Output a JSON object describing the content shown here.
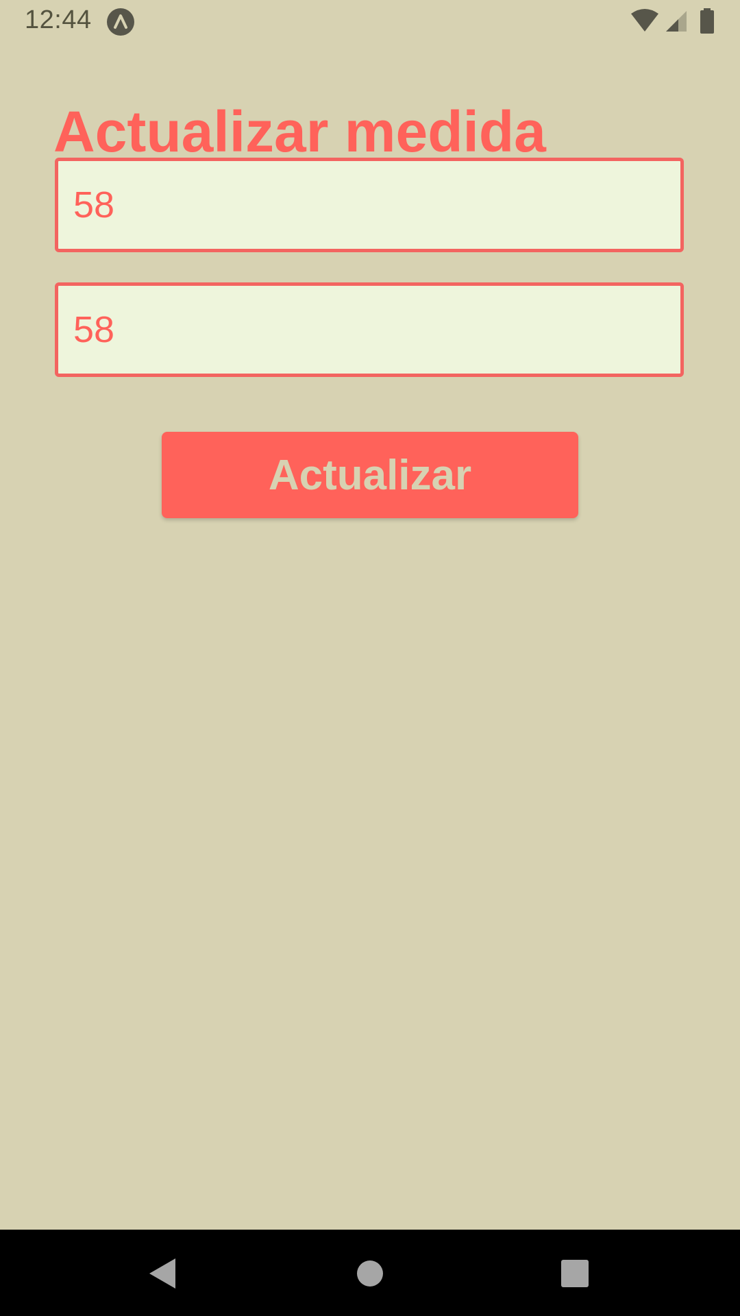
{
  "status_bar": {
    "time": "12:44",
    "icons": [
      "expo-icon",
      "wifi-icon",
      "signal-icon",
      "battery-icon"
    ]
  },
  "screen": {
    "title": "Actualizar medida"
  },
  "form": {
    "field_1": {
      "value": "58",
      "placeholder": ""
    },
    "field_2": {
      "value": "58",
      "placeholder": ""
    },
    "submit_label": "Actualizar"
  },
  "nav_bar": {
    "icons": [
      "back-icon",
      "home-icon",
      "recents-icon"
    ]
  },
  "colors": {
    "background": "#d7d2b2",
    "accent": "#ff625a",
    "field_background": "#eef5dc",
    "field_border": "#f36460",
    "status_icons": "#57564a",
    "nav_background": "#000000"
  }
}
